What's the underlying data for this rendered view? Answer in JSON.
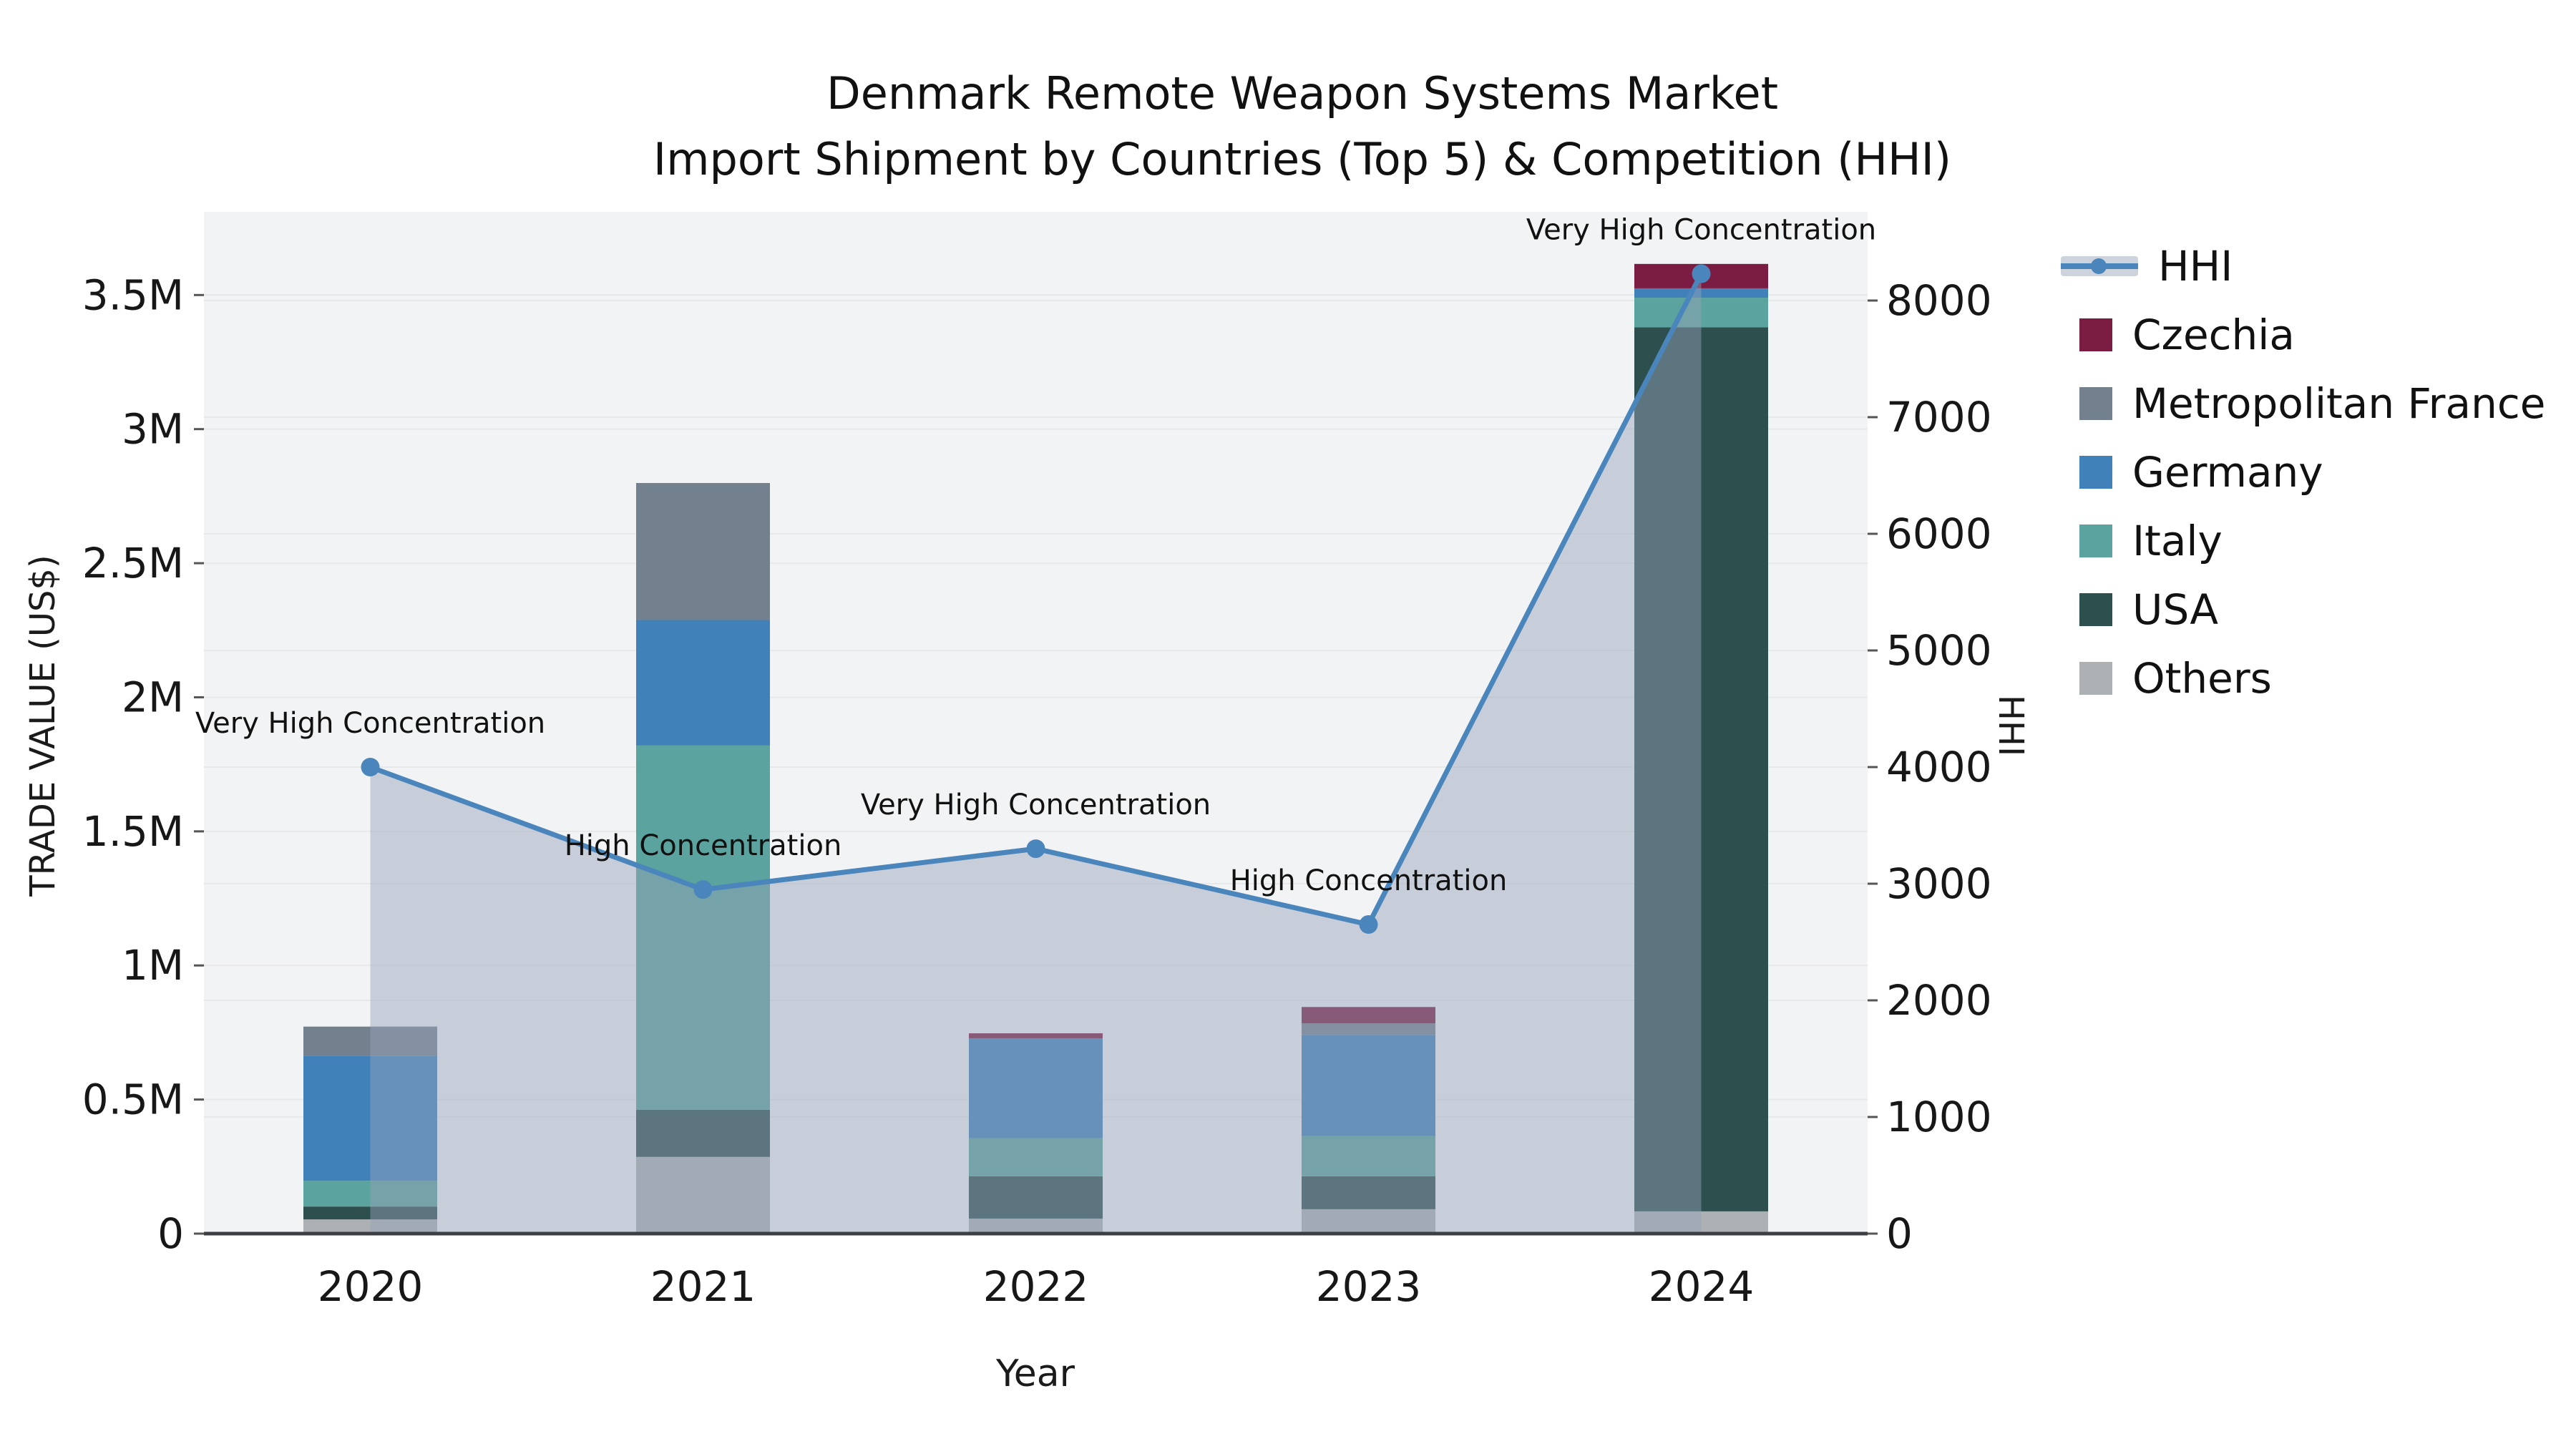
{
  "title": {
    "line1": "Denmark Remote Weapon Systems Market",
    "line2": "Import Shipment by Countries (Top 5) & Competition (HHI)"
  },
  "axes": {
    "left": {
      "title": "TRADE VALUE (US$)",
      "ticks": [
        "0",
        "0.5M",
        "1M",
        "1.5M",
        "2M",
        "2.5M",
        "3M",
        "3.5M"
      ]
    },
    "right": {
      "title": "HHI",
      "ticks": [
        "0",
        "1000",
        "2000",
        "3000",
        "4000",
        "5000",
        "6000",
        "7000",
        "8000"
      ]
    },
    "x": {
      "title": "Year"
    }
  },
  "chart_data": {
    "type": "bar+line",
    "categories": [
      "2020",
      "2021",
      "2022",
      "2023",
      "2024"
    ],
    "stack_note": "series listed bottom-to-top in stacking order; values in US$",
    "series": [
      {
        "name": "Others",
        "color": "#adb0b3",
        "values": [
          53000,
          286000,
          56000,
          91000,
          83000
        ]
      },
      {
        "name": "USA",
        "color": "#2d4f4e",
        "values": [
          48000,
          176000,
          158000,
          123000,
          3297000
        ]
      },
      {
        "name": "Italy",
        "color": "#5ba39e",
        "values": [
          96000,
          1358000,
          142000,
          150000,
          110000
        ]
      },
      {
        "name": "Germany",
        "color": "#4181ba",
        "values": [
          465000,
          468000,
          372000,
          377000,
          35000
        ]
      },
      {
        "name": "Metropolitan France",
        "color": "#73818f",
        "values": [
          110000,
          511000,
          0,
          43000,
          0
        ]
      },
      {
        "name": "Czechia",
        "color": "#7b1c42",
        "values": [
          0,
          0,
          19000,
          61000,
          91000
        ]
      }
    ],
    "hhi": {
      "name": "HHI",
      "values": [
        4000,
        2950,
        3300,
        2650,
        8230
      ]
    },
    "annotations": [
      {
        "year": "2020",
        "text": "Very High Concentration"
      },
      {
        "year": "2021",
        "text": "High Concentration"
      },
      {
        "year": "2022",
        "text": "Very High Concentration"
      },
      {
        "year": "2023",
        "text": "High Concentration"
      },
      {
        "year": "2024",
        "text": "Very High Concentration"
      }
    ],
    "ylim_left": [
      0,
      3500000
    ],
    "ylim_right": [
      0,
      8000
    ],
    "grid": true,
    "legend_position": "right"
  },
  "legend": {
    "items": [
      {
        "label": "HHI",
        "type": "line",
        "color": "#4a86bc"
      },
      {
        "label": "Czechia",
        "type": "square",
        "color": "#7b1c42"
      },
      {
        "label": "Metropolitan France",
        "type": "square",
        "color": "#73818f"
      },
      {
        "label": "Germany",
        "type": "square",
        "color": "#4181ba"
      },
      {
        "label": "Italy",
        "type": "square",
        "color": "#5ba39e"
      },
      {
        "label": "USA",
        "type": "square",
        "color": "#2d4f4e"
      },
      {
        "label": "Others",
        "type": "square",
        "color": "#adb0b3"
      }
    ]
  },
  "colors": {
    "plot_bg": "#f2f3f4",
    "grid": "#e7e8ea",
    "axis_line": "#3b3f44",
    "text": "#171717",
    "hhi_line": "#4a86bc",
    "hhi_area": "rgba(150,163,186,0.46)"
  }
}
